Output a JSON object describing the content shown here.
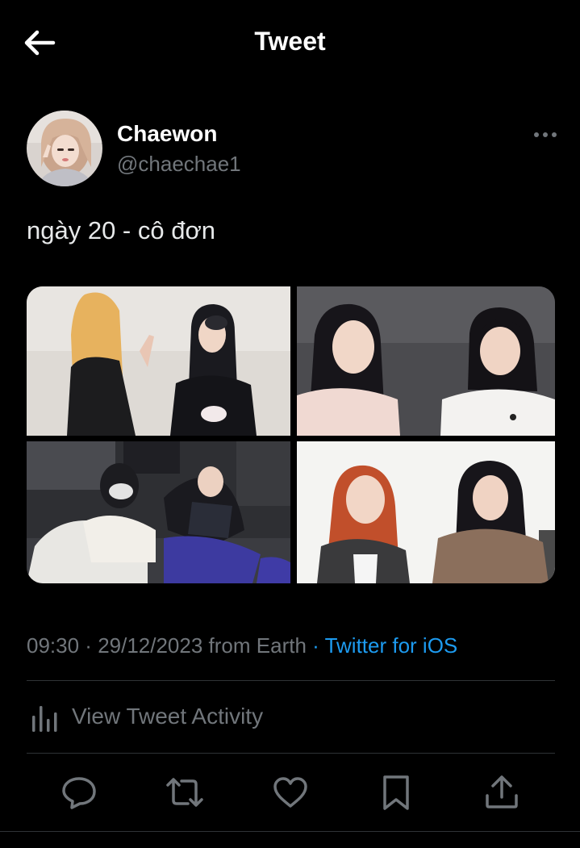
{
  "header": {
    "title": "Tweet",
    "back_icon": "arrow-left-icon"
  },
  "author": {
    "display_name": "Chaewon",
    "handle": "@chaechae1"
  },
  "tweet": {
    "text": "ngày 20 - cô đơn",
    "photos": 4
  },
  "meta": {
    "time": "09:30",
    "separator": " · ",
    "date": "29/12/2023",
    "location_text": " from Earth",
    "source_separator": " · ",
    "source": "Twitter for iOS"
  },
  "activity": {
    "label": "View Tweet Activity",
    "icon": "analytics-bars-icon"
  },
  "actions": [
    {
      "name": "reply",
      "icon": "speech-bubble-icon"
    },
    {
      "name": "retweet",
      "icon": "retweet-arrows-icon"
    },
    {
      "name": "like",
      "icon": "heart-icon"
    },
    {
      "name": "bookmark",
      "icon": "bookmark-icon"
    },
    {
      "name": "share",
      "icon": "share-upload-icon"
    }
  ],
  "colors": {
    "background": "#000000",
    "text": "#e7e9ea",
    "secondary_text": "#71767b",
    "link": "#1d9bf0",
    "divider": "#2f3336"
  }
}
